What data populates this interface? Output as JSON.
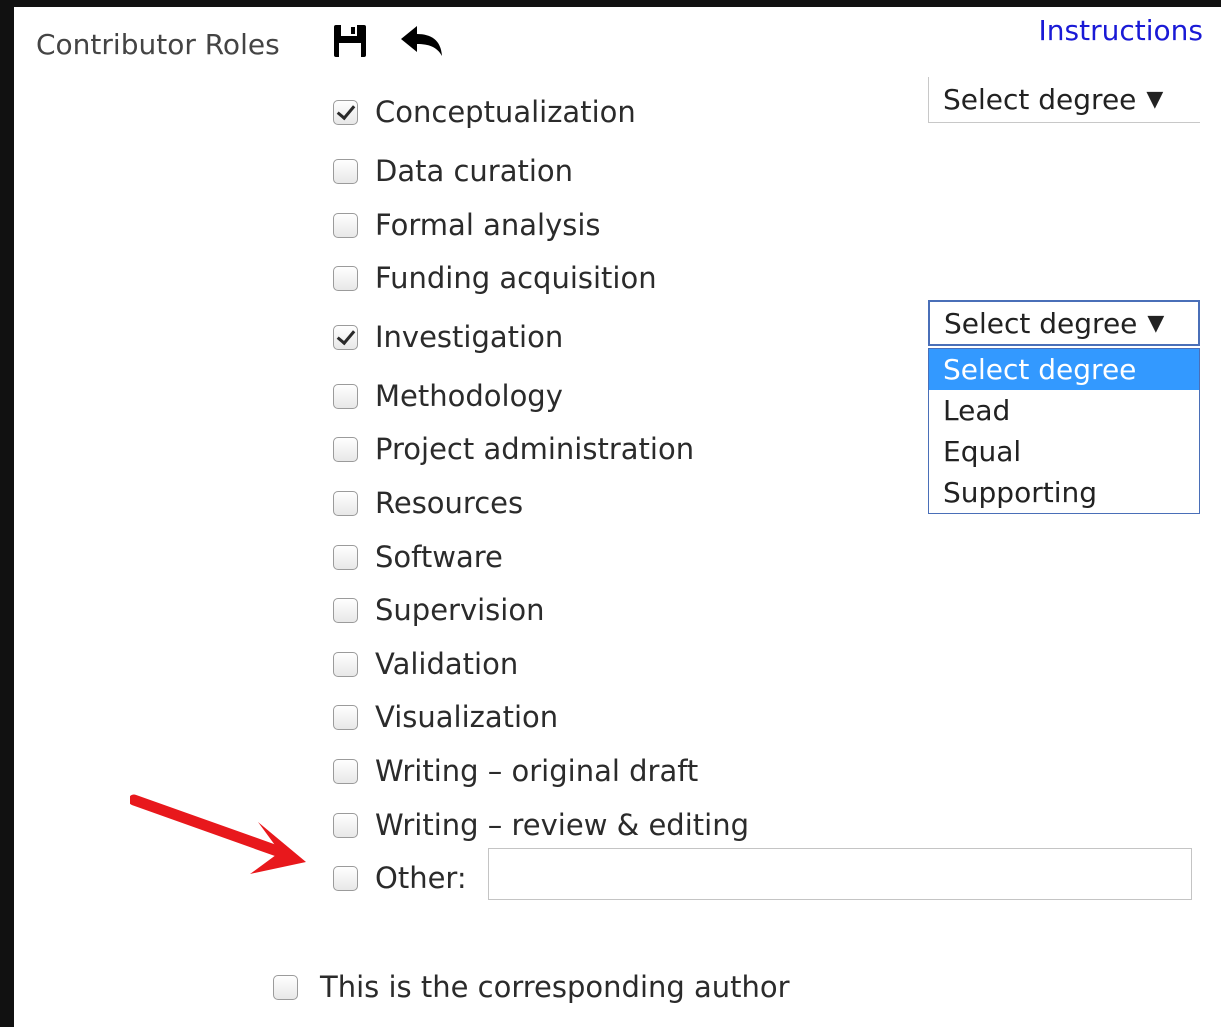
{
  "header": {
    "section_label": "Contributor Roles",
    "instructions_link": "Instructions"
  },
  "icons": {
    "save": "floppy-disk-icon",
    "back": "reply-arrow-icon",
    "checkmark": "checkmark-icon",
    "dropdown_caret": "triangle-down-icon",
    "annotation": "red-arrow-icon"
  },
  "roles": [
    {
      "label": "Conceptualization",
      "checked": true
    },
    {
      "label": "Data curation",
      "checked": false
    },
    {
      "label": "Formal analysis",
      "checked": false
    },
    {
      "label": "Funding acquisition",
      "checked": false
    },
    {
      "label": "Investigation",
      "checked": true
    },
    {
      "label": "Methodology",
      "checked": false
    },
    {
      "label": "Project administration",
      "checked": false
    },
    {
      "label": "Resources",
      "checked": false
    },
    {
      "label": "Software",
      "checked": false
    },
    {
      "label": "Supervision",
      "checked": false
    },
    {
      "label": "Validation",
      "checked": false
    },
    {
      "label": "Visualization",
      "checked": false
    },
    {
      "label": "Writing – original draft",
      "checked": false
    },
    {
      "label": "Writing – review & editing",
      "checked": false
    },
    {
      "label": "Other:",
      "checked": false
    }
  ],
  "other_input": {
    "value": "",
    "placeholder": ""
  },
  "degree_selects": {
    "conceptualization": {
      "selected": "Select degree",
      "caret": "▼"
    },
    "investigation": {
      "selected": "Select degree",
      "caret": "▼",
      "open": true
    }
  },
  "degree_options": [
    "Select degree",
    "Lead",
    "Equal",
    "Supporting"
  ],
  "corresponding_author": {
    "label": "This is the corresponding author",
    "checked": false
  },
  "colors": {
    "link": "#1a1ad6",
    "dropdown_highlight": "#3399ff",
    "open_select_border": "#4a6fb8",
    "annotation_arrow": "#e8181c",
    "frame": "#111111"
  }
}
